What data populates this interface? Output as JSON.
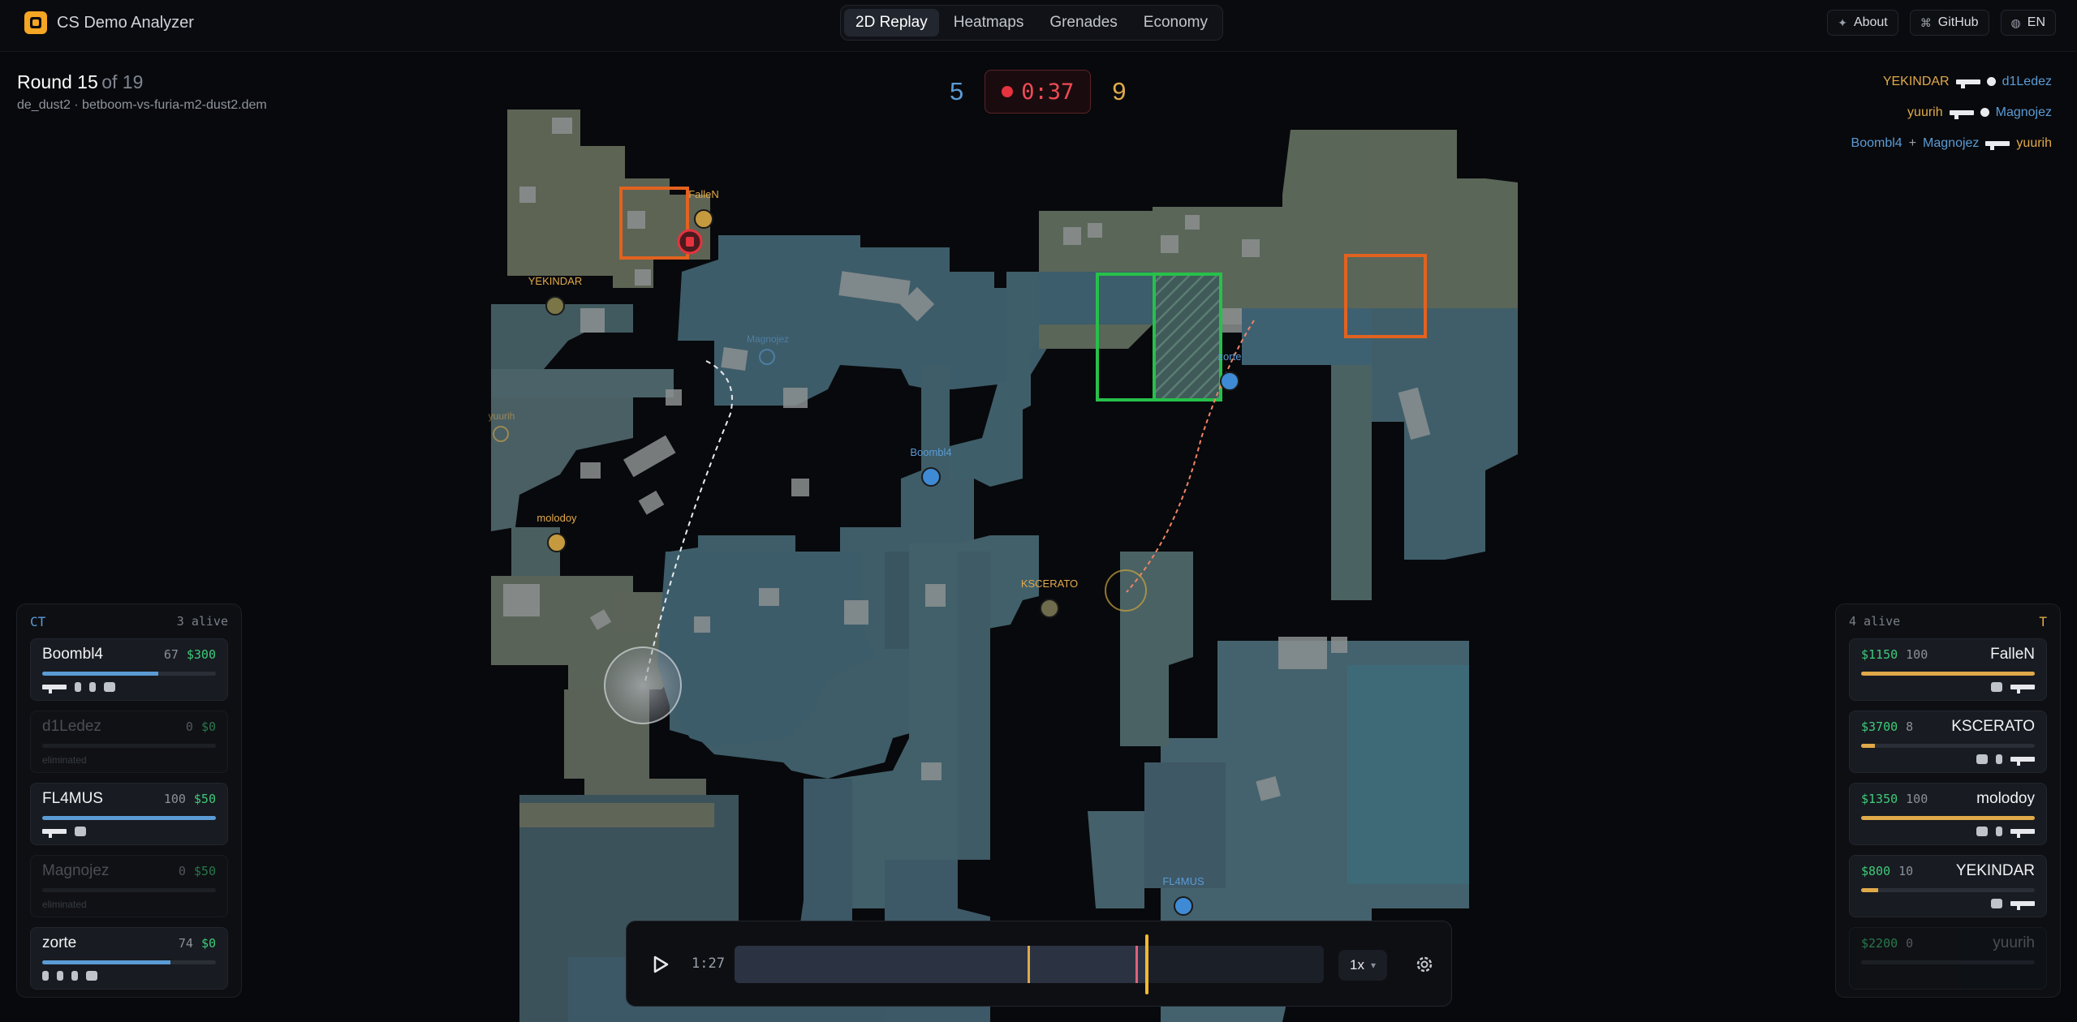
{
  "app": {
    "title": "CS Demo Analyzer"
  },
  "nav": {
    "tabs": [
      {
        "label": "2D Replay",
        "active": true
      },
      {
        "label": "Heatmaps",
        "active": false
      },
      {
        "label": "Grenades",
        "active": false
      },
      {
        "label": "Economy",
        "active": false
      }
    ],
    "about": "About",
    "github": "GitHub",
    "language": "EN"
  },
  "round": {
    "label": "Round 15",
    "of": "of 19",
    "file": "de_dust2 · betboom-vs-furia-m2-dust2.dem"
  },
  "score": {
    "ct": "5",
    "t": "9",
    "timer": "0:37"
  },
  "killfeed": [
    {
      "killer": "YEKINDAR",
      "killer_side": "t",
      "assist": "",
      "victim": "d1Ledez",
      "victim_side": "ct",
      "headshot": true
    },
    {
      "killer": "yuurih",
      "killer_side": "t",
      "assist": "",
      "victim": "Magnojez",
      "victim_side": "ct",
      "headshot": true
    },
    {
      "killer": "Boombl4",
      "killer_side": "ct",
      "assist": "Magnojez",
      "plus": "+",
      "victim": "yuurih",
      "victim_side": "t",
      "headshot": false
    }
  ],
  "ct_team": {
    "side": "CT",
    "alive": "3 alive",
    "color": "#5b9bd5",
    "players": [
      {
        "name": "Boombl4",
        "hp": "67",
        "money": "$300",
        "hp_fraction": 0.67,
        "dead": false,
        "gear": [
          "rifle",
          "nade",
          "nade",
          "kit"
        ]
      },
      {
        "name": "d1Ledez",
        "hp": "0",
        "money": "$0",
        "hp_fraction": 0,
        "dead": true,
        "status": "eliminated"
      },
      {
        "name": "FL4MUS",
        "hp": "100",
        "money": "$50",
        "hp_fraction": 1.0,
        "dead": false,
        "gear": [
          "rifle",
          "kit"
        ]
      },
      {
        "name": "Magnojez",
        "hp": "0",
        "money": "$50",
        "hp_fraction": 0,
        "dead": true,
        "status": "eliminated"
      },
      {
        "name": "zorte",
        "hp": "74",
        "money": "$0",
        "hp_fraction": 0.74,
        "dead": false,
        "gear": [
          "nade",
          "nade",
          "nade",
          "kit"
        ]
      }
    ]
  },
  "t_team": {
    "side": "T",
    "alive": "4 alive",
    "color": "#e0a94a",
    "players": [
      {
        "name": "FalleN",
        "hp": "100",
        "money": "$1150",
        "hp_fraction": 1.0,
        "dead": false,
        "gear": [
          "kit",
          "rifle"
        ]
      },
      {
        "name": "KSCERATO",
        "hp": "8",
        "money": "$3700",
        "hp_fraction": 0.08,
        "dead": false,
        "gear": [
          "kit",
          "nade",
          "rifle"
        ]
      },
      {
        "name": "molodoy",
        "hp": "100",
        "money": "$1350",
        "hp_fraction": 1.0,
        "dead": false,
        "gear": [
          "kit",
          "nade",
          "rifle"
        ]
      },
      {
        "name": "YEKINDAR",
        "hp": "10",
        "money": "$800",
        "hp_fraction": 0.1,
        "dead": false,
        "gear": [
          "kit",
          "rifle"
        ]
      },
      {
        "name": "yuurih",
        "hp": "0",
        "money": "$2200",
        "hp_fraction": 0,
        "dead": true
      }
    ]
  },
  "map_players": [
    {
      "name": "FalleN",
      "side": "t"
    },
    {
      "name": "YEKINDAR",
      "side": "t"
    },
    {
      "name": "molodoy",
      "side": "t"
    },
    {
      "name": "KSCERATO",
      "side": "t"
    },
    {
      "name": "yuurih",
      "side": "t",
      "dead": true
    },
    {
      "name": "Magnojez",
      "side": "ct",
      "dead": true
    },
    {
      "name": "Boombl4",
      "side": "ct"
    },
    {
      "name": "zorte",
      "side": "ct"
    },
    {
      "name": "FL4MUS",
      "side": "ct"
    }
  ],
  "player": {
    "elapsed": "1:27",
    "speed": "1x",
    "progress": 0.7,
    "markers": [
      {
        "fraction": 0.497,
        "color": "#e0a94a"
      },
      {
        "fraction": 0.68,
        "color": "#e0627a"
      }
    ]
  },
  "colors": {
    "ct": "#5b9bd5",
    "t": "#e0a94a",
    "accent": "#f5a623",
    "timer": "#ef4b55"
  }
}
